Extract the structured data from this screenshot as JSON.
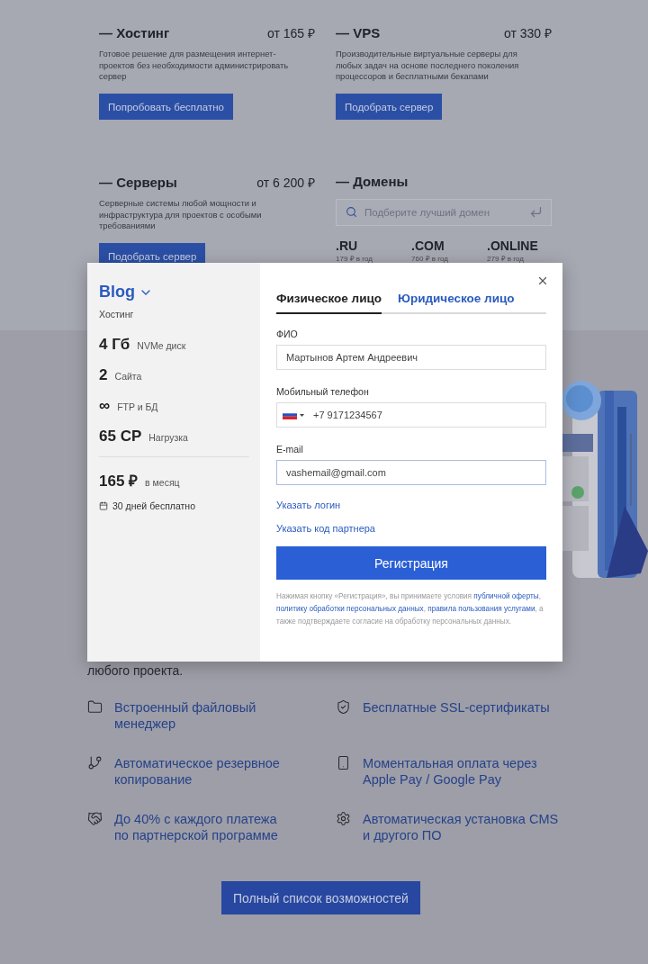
{
  "products": [
    {
      "title": "— Хостинг",
      "price": "от 165 ₽",
      "description": "Готовое решение для размещения интернет-проектов без необходимости администрировать сервер",
      "button": "Попробовать бесплатно"
    },
    {
      "title": "— VPS",
      "price": "от 330 ₽",
      "description": "Производительные виртуальные серверы для любых задач на основе последнего поколения процессоров и бесплатными бекапами",
      "button": "Подобрать сервер"
    },
    {
      "title": "— Серверы",
      "price": "от 6 200 ₽",
      "description": "Серверные системы любой мощности и инфраструктура для проектов с особыми требованиями",
      "button": "Подобрать сервер"
    }
  ],
  "domains": {
    "title": "— Домены",
    "search": {
      "placeholder": "Подберите лучший домен"
    },
    "zones": [
      {
        "name": ".RU",
        "price": "179 ₽ в год"
      },
      {
        "name": ".COM",
        "price": "760 ₽ в год"
      },
      {
        "name": ".ONLINE",
        "price": "279 ₽ в год"
      }
    ]
  },
  "intro_tail": "любого проекта.",
  "features": [
    {
      "text": "Встроенный файловый менеджер"
    },
    {
      "text": "Бесплатные SSL-сертификаты"
    },
    {
      "text": "Автоматическое резервное копирование"
    },
    {
      "text": "Моментальная оплата через Apple Pay / Google Pay"
    },
    {
      "text": "До 40% с каждого платежа по партнерской программе"
    },
    {
      "text": "Автоматическая установка CMS и другого ПО"
    }
  ],
  "more_button": "Полный список возможностей",
  "modal": {
    "plan": {
      "name": "Blog",
      "category": "Хостинг",
      "specs": [
        {
          "value": "4 Гб",
          "label": "NVMe диск"
        },
        {
          "value": "2",
          "label": "Сайта"
        },
        {
          "value": "∞",
          "label": "FTP и БД"
        },
        {
          "value": "65 CP",
          "label": "Нагрузка"
        }
      ],
      "price": "165 ₽",
      "period": "в месяц",
      "trial": "30 дней бесплатно"
    },
    "tabs": [
      {
        "label": "Физическое лицо",
        "selected": true
      },
      {
        "label": "Юридическое лицо",
        "selected": false
      }
    ],
    "fields": [
      {
        "kind": "text",
        "label": "ФИО",
        "value": "Мартынов Артем Андреевич",
        "focused": false
      },
      {
        "kind": "phone",
        "label": "Мобильный телефон",
        "value": "+7 9171234567",
        "focused": false
      },
      {
        "kind": "text",
        "label": "E-mail",
        "value": "vashemail@gmail.com",
        "focused": true
      }
    ],
    "links": [
      "Указать логин",
      "Указать код партнера"
    ],
    "submit": "Регистрация",
    "legal": [
      {
        "text": "Нажимая кнопку «Регистрация», вы принимаете условия ",
        "link": false
      },
      {
        "text": "публичной оферты",
        "link": true
      },
      {
        "text": ", ",
        "link": false
      },
      {
        "text": "политику обработки персональных данных",
        "link": true
      },
      {
        "text": ", ",
        "link": false
      },
      {
        "text": "правила пользования услугами",
        "link": true
      },
      {
        "text": ", а также подтверждаете согласие на обработку персональных данных.",
        "link": false
      }
    ]
  }
}
